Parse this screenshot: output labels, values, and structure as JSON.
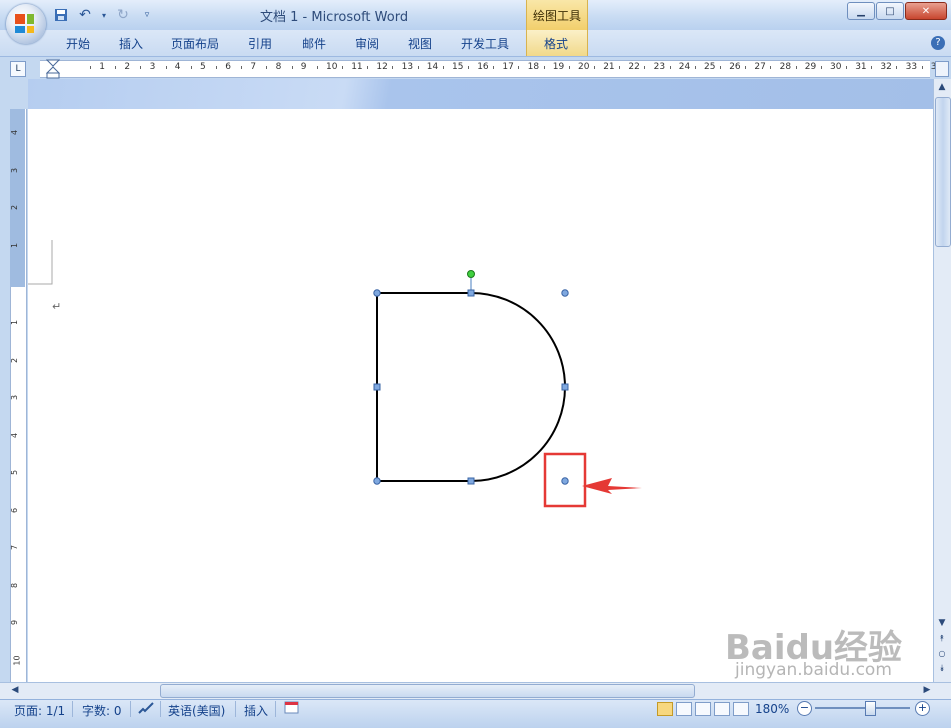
{
  "window": {
    "title": "文档 1 - Microsoft Word",
    "context_tab_group": "绘图工具"
  },
  "ribbon": {
    "tabs": [
      "开始",
      "插入",
      "页面布局",
      "引用",
      "邮件",
      "审阅",
      "视图",
      "开发工具",
      "格式"
    ]
  },
  "ruler": {
    "horizontal_ticks": [
      "1",
      "2",
      "3",
      "4",
      "5",
      "6",
      "7",
      "8",
      "9",
      "10",
      "11",
      "12",
      "13",
      "14",
      "15",
      "16",
      "17",
      "18",
      "19",
      "20",
      "21",
      "22",
      "23",
      "24",
      "25",
      "26",
      "27",
      "28",
      "29",
      "30",
      "31",
      "32",
      "33",
      "34"
    ],
    "vertical_ticks_top": [
      "4",
      "3",
      "2",
      "1"
    ],
    "vertical_ticks_bottom": [
      "1",
      "2",
      "3",
      "4",
      "5",
      "6",
      "7",
      "8",
      "9",
      "10"
    ]
  },
  "document": {
    "paragraph_mark": "↵",
    "shape": "half-rounded rectangle (D shape)",
    "annotation_color": "#e53935"
  },
  "statusbar": {
    "page": "页面: 1/1",
    "words": "字数: 0",
    "language": "英语(美国)",
    "mode": "插入",
    "zoom": "180%"
  },
  "watermark": {
    "brand": "Baidu经验",
    "url": "jingyan.baidu.com"
  }
}
